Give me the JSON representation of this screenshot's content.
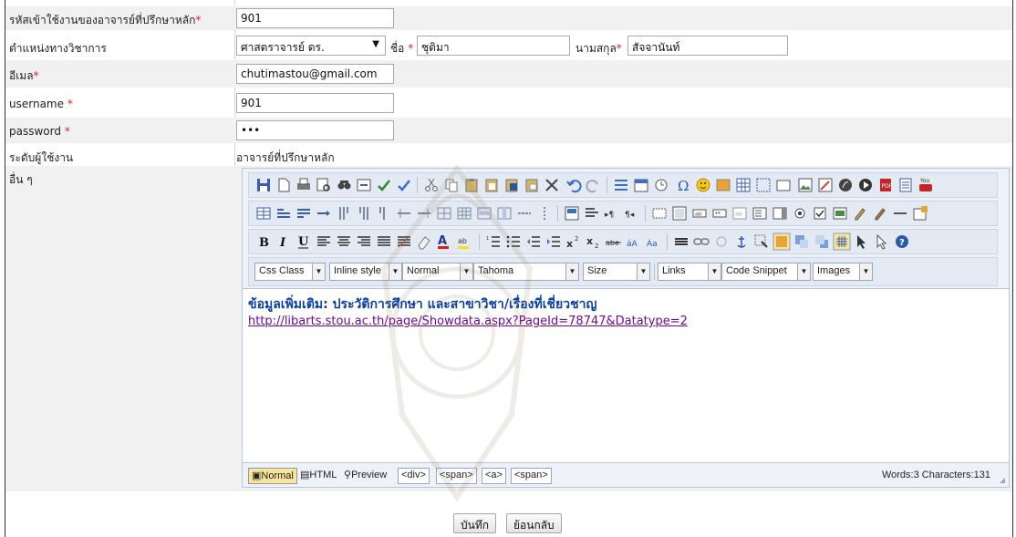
{
  "form": {
    "advisor_id": {
      "label": "รหัสเข้าใช้งานของอาจารย์ที่ปรึกษาหลัก",
      "required_mark": "*",
      "value": "901"
    },
    "academic_position": {
      "label": "ตำแหน่งทางวิชาการ",
      "value": "ศาสตราจารย์ ดร."
    },
    "first_name": {
      "label": "ชื่อ",
      "required_mark": "*",
      "value": "ชุติมา"
    },
    "last_name": {
      "label": "นามสกุล",
      "required_mark": "*",
      "value": "สัจจานันท์"
    },
    "email": {
      "label": "อีเมล",
      "required_mark": "*",
      "value": "chutimastou@gmail.com"
    },
    "username": {
      "label": "username",
      "required_mark": "*",
      "value": "901"
    },
    "password": {
      "label": "password",
      "required_mark": "*",
      "value": "•••"
    },
    "user_level": {
      "label": "ระดับผู้ใช้งาน",
      "value": "อาจารย์ที่ปรึกษาหลัก"
    },
    "other": {
      "label": "อื่น ๆ"
    }
  },
  "editor": {
    "dropdowns": [
      "Css Class",
      "Inline style",
      "Normal",
      "Tahoma",
      "Size",
      "Links",
      "Code Snippet",
      "Images"
    ],
    "content_heading": "ข้อมูลเพิ่มเติม: ประวัติการศึกษา และสาขาวิชา/เรื่องที่เชี่ยวชาญ",
    "content_link": "http://libarts.stou.ac.th/page/Showdata.aspx?PageId=78747&Datatype=2",
    "modes": [
      "Normal",
      "HTML",
      "Preview"
    ],
    "tags": [
      "<div>",
      "<span>",
      "<a>",
      "<span>"
    ],
    "word_count": "Words:3 Characters:131"
  },
  "buttons": {
    "save": "บันทึก",
    "back": "ย้อนกลับ"
  },
  "colors": {
    "required": "#e0202a",
    "heading": "#0b3f9e",
    "link": "#6a0d8f",
    "row_shade": "#f1f1f1"
  }
}
